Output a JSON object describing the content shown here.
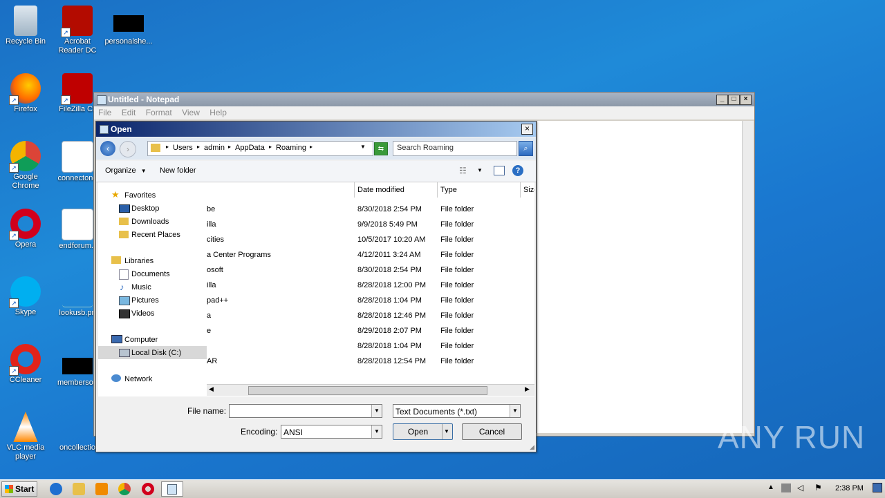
{
  "desktop": {
    "icons": [
      {
        "label": "Recycle Bin"
      },
      {
        "label": "Acrobat Reader DC"
      },
      {
        "label": "personalshe..."
      },
      {
        "label": "Firefox"
      },
      {
        "label": "FileZilla Cli"
      },
      {
        "label": "Google Chrome"
      },
      {
        "label": "connectone"
      },
      {
        "label": "Opera"
      },
      {
        "label": "endforum.r"
      },
      {
        "label": "Skype"
      },
      {
        "label": "lookusb.pn"
      },
      {
        "label": "CCleaner"
      },
      {
        "label": "membersop"
      },
      {
        "label": "VLC media player"
      },
      {
        "label": "oncollectio"
      }
    ]
  },
  "notepad": {
    "title": "Untitled - Notepad",
    "menu": [
      "File",
      "Edit",
      "Format",
      "View",
      "Help"
    ]
  },
  "dialog": {
    "title": "Open",
    "breadcrumb": [
      "Users",
      "admin",
      "AppData",
      "Roaming"
    ],
    "search_placeholder": "Search Roaming",
    "toolbar": {
      "organize": "Organize",
      "new_folder": "New folder"
    },
    "nav": {
      "favorites": "Favorites",
      "favorites_items": [
        "Desktop",
        "Downloads",
        "Recent Places"
      ],
      "libraries": "Libraries",
      "libraries_items": [
        "Documents",
        "Music",
        "Pictures",
        "Videos"
      ],
      "computer": "Computer",
      "computer_items": [
        "Local Disk (C:)"
      ],
      "network": "Network"
    },
    "columns": [
      "Date modified",
      "Type",
      "Size"
    ],
    "rows": [
      {
        "name": "be",
        "date": "8/30/2018 2:54 PM",
        "type": "File folder"
      },
      {
        "name": "illa",
        "date": "9/9/2018 5:49 PM",
        "type": "File folder"
      },
      {
        "name": "cities",
        "date": "10/5/2017 10:20 AM",
        "type": "File folder"
      },
      {
        "name": "a Center Programs",
        "date": "4/12/2011 3:24 AM",
        "type": "File folder"
      },
      {
        "name": "osoft",
        "date": "8/30/2018 2:54 PM",
        "type": "File folder"
      },
      {
        "name": "illa",
        "date": "8/28/2018 12:00 PM",
        "type": "File folder"
      },
      {
        "name": "pad++",
        "date": "8/28/2018 1:04 PM",
        "type": "File folder"
      },
      {
        "name": "a",
        "date": "8/28/2018 12:46 PM",
        "type": "File folder"
      },
      {
        "name": "e",
        "date": "8/29/2018 2:07 PM",
        "type": "File folder"
      },
      {
        "name": "",
        "date": "8/28/2018 1:04 PM",
        "type": "File folder"
      },
      {
        "name": "AR",
        "date": "8/28/2018 12:54 PM",
        "type": "File folder"
      }
    ],
    "file_name_label": "File name:",
    "file_name_value": "",
    "filter_value": "Text Documents (*.txt)",
    "encoding_label": "Encoding:",
    "encoding_value": "ANSI",
    "open_label": "Open",
    "cancel_label": "Cancel"
  },
  "taskbar": {
    "start_label": "Start",
    "clock": "2:38 PM"
  },
  "watermark": "ANY RUN"
}
